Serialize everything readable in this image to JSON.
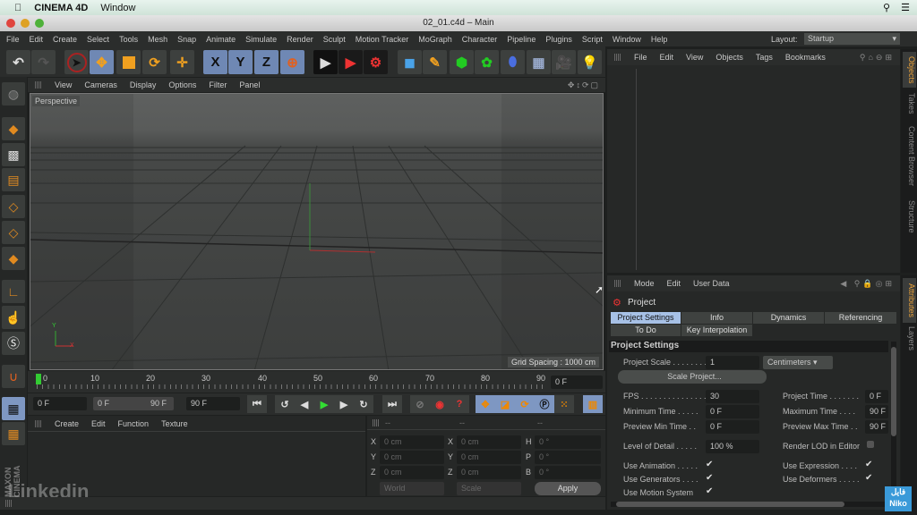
{
  "os_menu": {
    "app": "CINEMA 4D",
    "window": "Window"
  },
  "window_title": "02_01.c4d – Main",
  "menu": [
    "File",
    "Edit",
    "Create",
    "Select",
    "Tools",
    "Mesh",
    "Snap",
    "Animate",
    "Simulate",
    "Render",
    "Sculpt",
    "Motion Tracker",
    "MoGraph",
    "Character",
    "Pipeline",
    "Plugins",
    "Script",
    "Window",
    "Help"
  ],
  "layout": {
    "label": "Layout:",
    "value": "Startup"
  },
  "toolbar": {
    "axis_x": "X",
    "axis_y": "Y",
    "axis_z": "Z"
  },
  "viewport": {
    "menu": [
      "View",
      "Cameras",
      "Display",
      "Options",
      "Filter",
      "Panel"
    ],
    "camera_label": "Perspective",
    "grid_spacing": "Grid Spacing : 1000 cm",
    "axis_y": "Y",
    "axis_x": "X"
  },
  "timeline": {
    "ticks": [
      "0",
      "10",
      "20",
      "30",
      "40",
      "50",
      "60",
      "70",
      "80",
      "90"
    ],
    "current_frame": "0 F"
  },
  "transport": {
    "start": "0 F",
    "range_min": "0 F",
    "range_max": "90 F",
    "end": "90 F"
  },
  "material_menu": [
    "Create",
    "Edit",
    "Function",
    "Texture"
  ],
  "coordinates": {
    "headers": [
      "--",
      "--",
      "--"
    ],
    "rows": [
      {
        "a": "X",
        "av": "0 cm",
        "b": "X",
        "bv": "0 cm",
        "c": "H",
        "cv": "0 °"
      },
      {
        "a": "Y",
        "av": "0 cm",
        "b": "Y",
        "bv": "0 cm",
        "c": "P",
        "cv": "0 °"
      },
      {
        "a": "Z",
        "av": "0 cm",
        "b": "Z",
        "bv": "0 cm",
        "c": "B",
        "cv": "0 °"
      }
    ],
    "world": "World",
    "scale": "Scale",
    "apply": "Apply"
  },
  "objects_menu": [
    "File",
    "Edit",
    "View",
    "Objects",
    "Tags",
    "Bookmarks"
  ],
  "right_tabs_top": [
    "Objects",
    "Takes",
    "Content Browser",
    "Structure"
  ],
  "right_tabs_bottom": [
    "Attributes",
    "Layers"
  ],
  "attributes": {
    "menu": [
      "Mode",
      "Edit",
      "User Data"
    ],
    "object": "Project",
    "tabs": [
      "Project Settings",
      "Info",
      "Dynamics",
      "Referencing",
      "To Do",
      "Key Interpolation"
    ],
    "section": "Project Settings",
    "project_scale_label": "Project Scale . . . . . . . .",
    "project_scale": "1",
    "unit": "Centimeters",
    "scale_project": "Scale Project...",
    "fps_label": "FPS . . . . . . . . . . . . . . .",
    "fps": "30",
    "min_time_label": "Minimum Time . . . . .",
    "min_time": "0 F",
    "prev_min_label": "Preview Min Time . .",
    "prev_min": "0 F",
    "proj_time_label": "Project Time . . . . . . .",
    "proj_time": "0 F",
    "max_time_label": "Maximum Time . . . .",
    "max_time": "90 F",
    "prev_max_label": "Preview Max Time . .",
    "prev_max": "90 F",
    "lod_label": "Level of Detail . . . . .",
    "lod": "100 %",
    "render_lod": "Render LOD in Editor",
    "use_animation": "Use Animation . . . . .",
    "use_generators": "Use Generators . . . .",
    "use_motion": "Use Motion System",
    "use_expression": "Use Expression . . . .",
    "use_deformers": "Use Deformers . . . . .",
    "check": "✔"
  },
  "watermark": {
    "linkedin": "Linkedin",
    "maxon": "MAXON CINEMA",
    "niko": "فایل Niko"
  },
  "colors": {
    "accent_tab": "#a7c1e6",
    "active_vtab": "#e8a13a",
    "bg": "#262827"
  }
}
